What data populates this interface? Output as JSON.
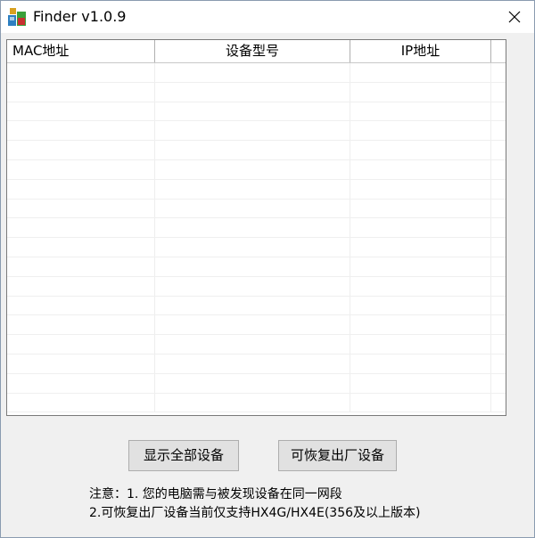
{
  "window": {
    "title": "Finder v1.0.9",
    "app_icon": "finder-app-icon",
    "close_icon": "close-icon"
  },
  "table": {
    "columns": [
      "MAC地址",
      "设备型号",
      "IP地址"
    ],
    "rows": []
  },
  "buttons": {
    "show_all": "显示全部设备",
    "restore": "可恢复出厂设备"
  },
  "notes": {
    "line1": "注意：1. 您的电脑需与被发现设备在同一网段",
    "line2": "2.可恢复出厂设备当前仅支持HX4G/HX4E(356及以上版本)"
  }
}
